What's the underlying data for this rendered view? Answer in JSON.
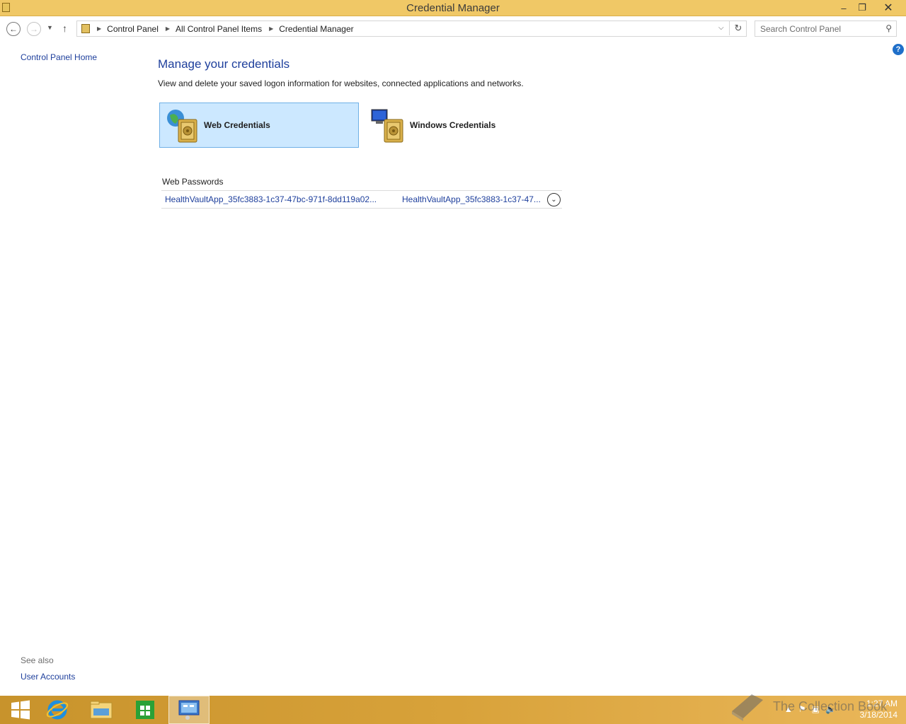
{
  "window": {
    "title": "Credential Manager",
    "minimize_glyph": "‒",
    "maximize_glyph": "❐",
    "close_glyph": "✕"
  },
  "navigation": {
    "breadcrumbs": [
      "Control Panel",
      "All Control Panel Items",
      "Credential Manager"
    ],
    "search_placeholder": "Search Control Panel"
  },
  "sidebar": {
    "home_link": "Control Panel Home",
    "see_also_label": "See also",
    "see_also_links": [
      "User Accounts"
    ]
  },
  "main": {
    "heading": "Manage your credentials",
    "description": "View and delete your saved logon information for websites, connected applications and networks.",
    "tiles": [
      {
        "label": "Web Credentials",
        "selected": true
      },
      {
        "label": "Windows Credentials",
        "selected": false
      }
    ],
    "section_title": "Web Passwords",
    "credentials": [
      {
        "name": "HealthVaultApp_35fc3883-1c37-47bc-971f-8dd119a02...",
        "account": "HealthVaultApp_35fc3883-1c37-47..."
      }
    ]
  },
  "taskbar": {
    "apps": [
      "start-button",
      "internet-explorer",
      "file-explorer",
      "store",
      "control-panel"
    ],
    "active_app": "control-panel",
    "clock_time": "1:27 AM",
    "clock_date": "3/18/2014"
  },
  "watermark": {
    "text": "The Collection Book"
  },
  "colors": {
    "titlebar": "#f0c866",
    "link": "#1e3f9c",
    "selected_tile": "#cce8ff",
    "taskbar": "#d8a23a"
  }
}
